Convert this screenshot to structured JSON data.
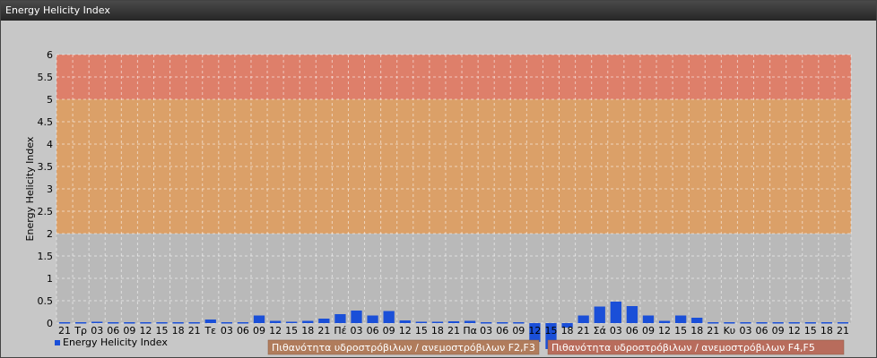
{
  "window": {
    "title": "Energy Helicity Index"
  },
  "chart_data": {
    "type": "bar",
    "ylabel": "Energy Helicity Index",
    "ylim": [
      -0.5,
      6
    ],
    "yticks": [
      "0",
      "0.5",
      "1",
      "1.5",
      "2",
      "2.5",
      "3",
      "3.5",
      "4",
      "4.5",
      "5",
      "5.5",
      "6"
    ],
    "categories": [
      "21",
      "Τρ",
      "03",
      "06",
      "09",
      "12",
      "15",
      "18",
      "21",
      "Τε",
      "03",
      "06",
      "09",
      "12",
      "15",
      "18",
      "21",
      "Πέ",
      "03",
      "06",
      "09",
      "12",
      "15",
      "18",
      "21",
      "Πα",
      "03",
      "06",
      "09",
      "12",
      "15",
      "18",
      "21",
      "Σά",
      "03",
      "06",
      "09",
      "12",
      "15",
      "18",
      "21",
      "Κυ",
      "03",
      "06",
      "09",
      "12",
      "15",
      "18",
      "21"
    ],
    "series": [
      {
        "name": "Energy Helicity Index",
        "color": "#1a4fd8",
        "values": [
          0.02,
          0.02,
          0.03,
          0.02,
          0.02,
          0.02,
          0.02,
          0.02,
          0.02,
          0.08,
          0.02,
          0.02,
          0.17,
          0.05,
          0.03,
          0.05,
          0.1,
          0.2,
          0.28,
          0.17,
          0.27,
          0.06,
          0.03,
          0.03,
          0.04,
          0.05,
          0.02,
          0.02,
          0.02,
          -0.42,
          -0.58,
          -0.1,
          0.17,
          0.37,
          0.48,
          0.38,
          0.17,
          0.05,
          0.17,
          0.12,
          0.02,
          0.02,
          0.02,
          0.02,
          0.02,
          0.02,
          0.02,
          0.02,
          0.02
        ]
      }
    ],
    "bands": [
      {
        "from": 0,
        "to": 2,
        "color": "#b9b9b9"
      },
      {
        "from": 2,
        "to": 5,
        "color": "#dba068"
      },
      {
        "from": 5,
        "to": 6,
        "color": "#de7f6a"
      }
    ],
    "band_legend": [
      {
        "label": "Πιθανότητα υδροστρόβιλων / ανεμοστρόβιλων F2,F3",
        "color": "#b07c5c"
      },
      {
        "label": "Πιθανότητα υδροστρόβιλων / ανεμοστρόβιλων F4,F5",
        "color": "#b86c5c"
      }
    ],
    "grid": true,
    "legend_position": "bottom-left"
  }
}
